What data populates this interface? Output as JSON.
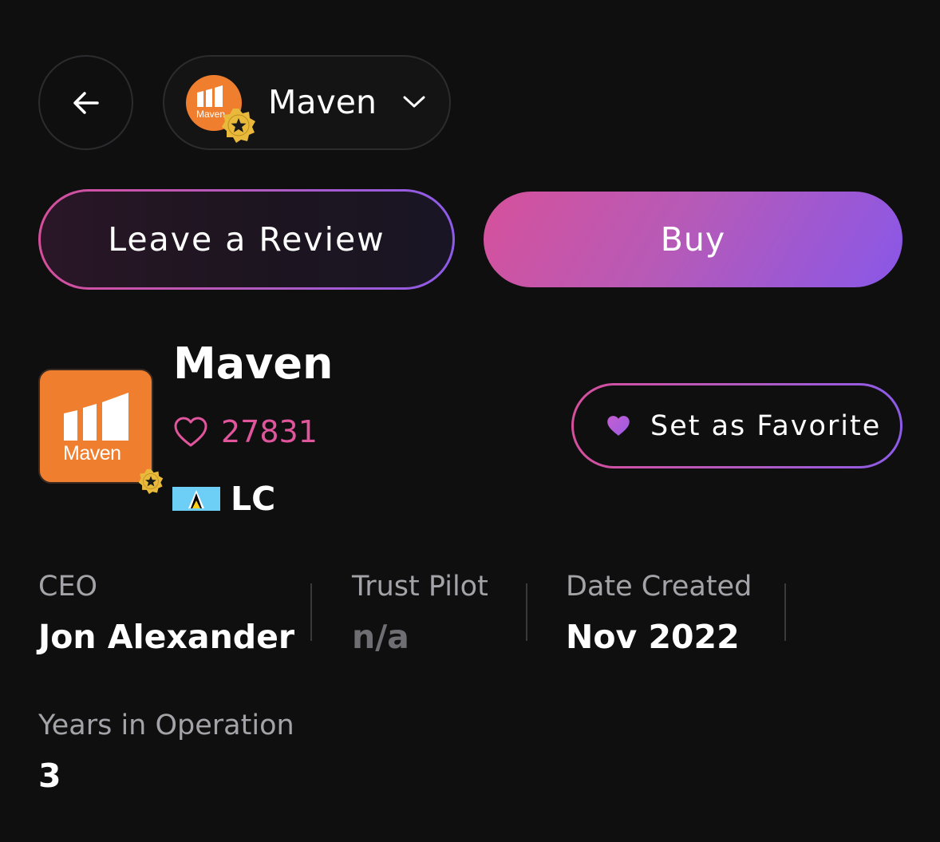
{
  "header": {
    "selected_company": "Maven"
  },
  "actions": {
    "review_label": "Leave a Review",
    "buy_label": "Buy",
    "favorite_label": "Set as Favorite"
  },
  "company": {
    "name": "Maven",
    "logo_text": "Maven",
    "likes": "27831",
    "country_code": "LC"
  },
  "info": {
    "ceo_label": "CEO",
    "ceo_value": "Jon Alexander",
    "trustpilot_label": "Trust Pilot",
    "trustpilot_value": "n/a",
    "date_label": "Date Created",
    "date_value": "Nov 2022",
    "years_label": "Years in Operation",
    "years_value": "3"
  },
  "colors": {
    "background": "#0f0f10",
    "brand_orange": "#ef7f2f",
    "accent_pink": "#d6519b",
    "accent_purple": "#8957e8",
    "badge_gold": "#e8b93a"
  },
  "icons": {
    "back": "arrow-left-icon",
    "dropdown": "chevron-down-icon",
    "verified": "verified-star-badge-icon",
    "likes": "heart-outline-icon",
    "favorite": "heart-filled-icon",
    "flag": "saint-lucia-flag-icon"
  }
}
